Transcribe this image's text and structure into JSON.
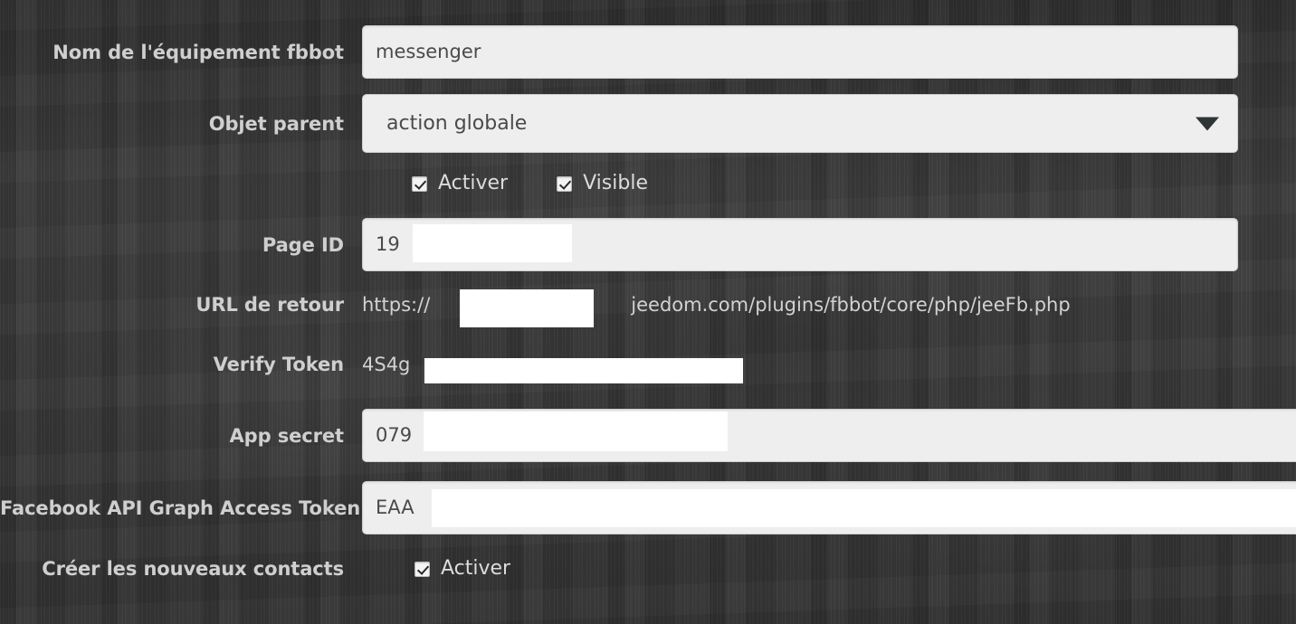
{
  "theme": {
    "background_color": "#3a3a3a",
    "label_color": "#cfcfcf",
    "input_background": "#eeeeee",
    "input_text_color": "#4a4a4a",
    "static_text_color": "#d2d2d2",
    "redaction_color": "#ffffff"
  },
  "form": {
    "fields": [
      {
        "label": "Nom de l'équipement fbbot",
        "type": "text",
        "value": "messenger"
      },
      {
        "label": "Objet parent",
        "type": "select",
        "value": "action globale",
        "arrow_icon": "chevron-down-icon"
      },
      {
        "label": "",
        "type": "checkbox-group",
        "checkboxes": [
          {
            "label": "Activer",
            "checked": true
          },
          {
            "label": "Visible",
            "checked": true
          }
        ]
      },
      {
        "label": "Page ID",
        "type": "text",
        "value": "19",
        "redacted": true
      },
      {
        "label": "URL de retour",
        "type": "static",
        "value_prefix": "https://",
        "value_suffix": "jeedom.com/plugins/fbbot/core/php/jeeFb.php",
        "redacted": true
      },
      {
        "label": "Verify Token",
        "type": "static",
        "value": "4S4g",
        "redacted": true
      },
      {
        "label": "App secret",
        "type": "text",
        "value": "079",
        "redacted": true
      },
      {
        "label": "Facebook API Graph Access Token",
        "type": "text",
        "value": "EAA",
        "redacted": true
      },
      {
        "label": "Créer les nouveaux contacts",
        "type": "checkbox-group",
        "checkboxes": [
          {
            "label": "Activer",
            "checked": true
          }
        ]
      }
    ]
  }
}
